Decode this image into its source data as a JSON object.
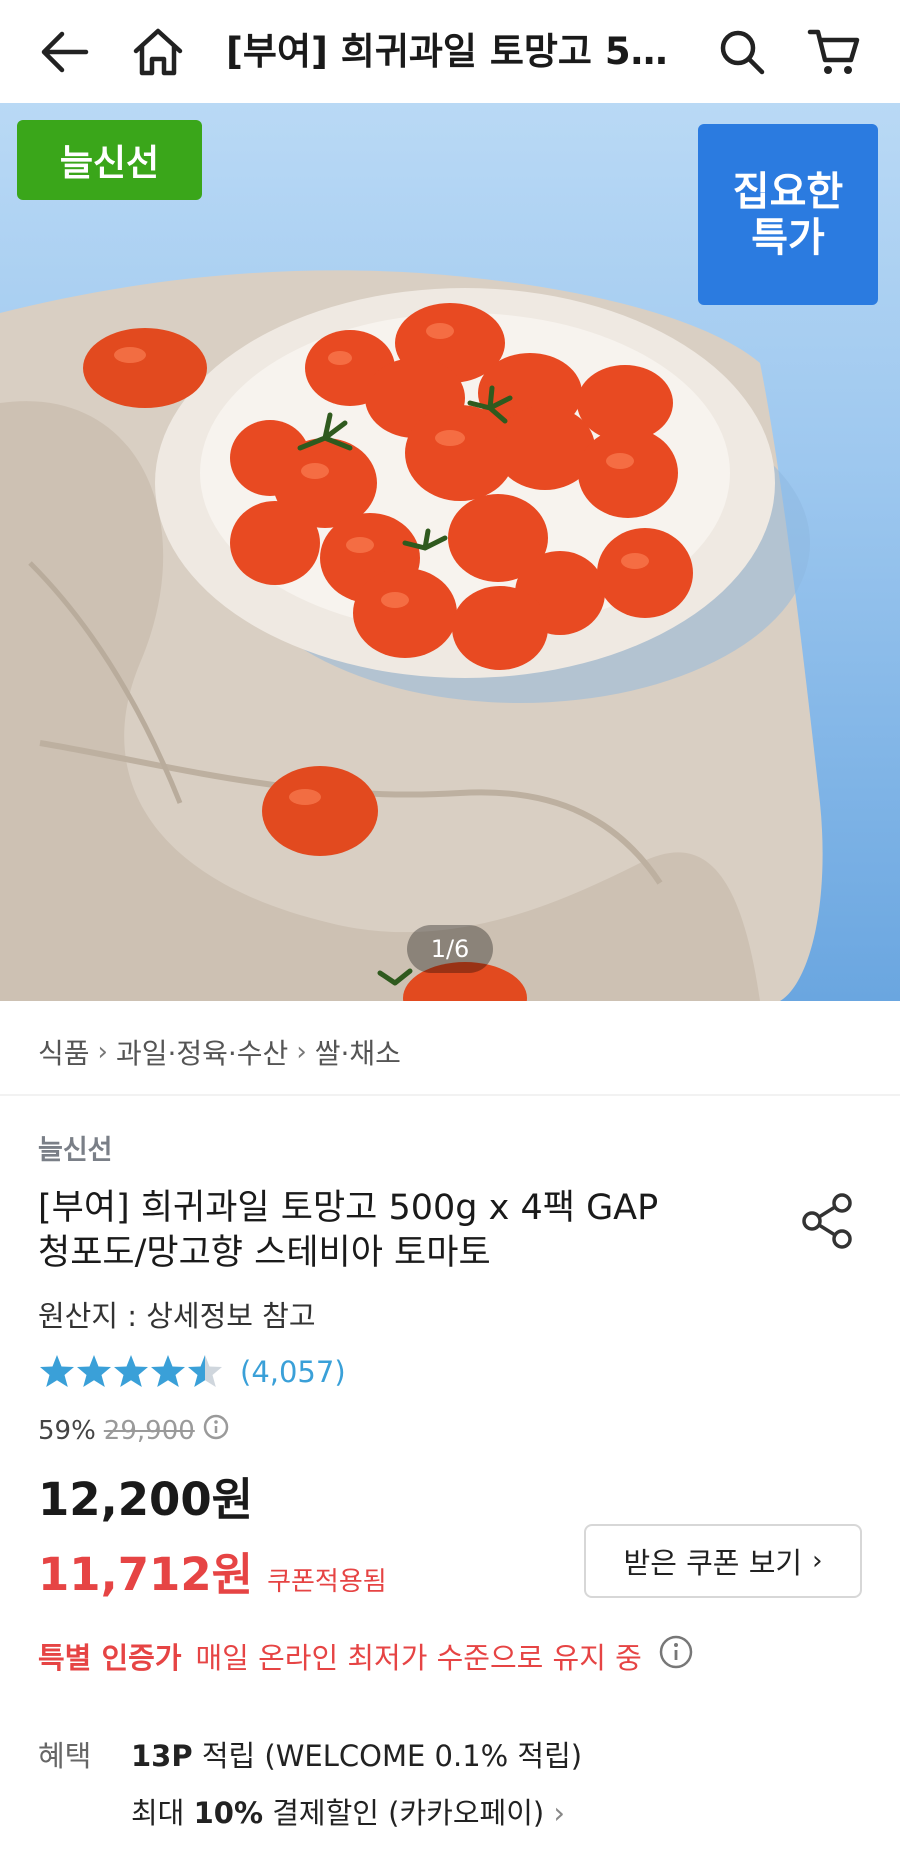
{
  "header": {
    "title": "[부여] 희귀과일 토망고 500g x 4팩 GAP 청포도/망고향 스테비아 토마토",
    "icons": [
      "back-arrow-icon",
      "home-icon",
      "search-icon",
      "cart-icon"
    ]
  },
  "hero": {
    "badge_fresh": "늘신선",
    "badge_deal_line1": "집요한",
    "badge_deal_line2": "특가",
    "pager": "1/6"
  },
  "breadcrumb": [
    "식품",
    "과일·정육·수산",
    "쌀·채소"
  ],
  "product": {
    "brand": "늘신선",
    "title_line1": "[부여] 희귀과일 토망고 500g x 4팩 GAP",
    "title_line2": "청포도/망고향 스테비아 토마토",
    "origin": "원산지 : 상세정보 참고",
    "rating_value": 4.5,
    "review_count": "(4,057)",
    "discount_rate": "59%",
    "original_price": "29,900",
    "price": "12,200원",
    "coupon_price": "11,712원",
    "coupon_applied_label": "쿠폰적용됨",
    "coupon_button": "받은 쿠폰 보기",
    "special_label": "특별 인증가",
    "special_desc": "매일 온라인 최저가 수준으로 유지 중"
  },
  "benefit": {
    "label": "혜택",
    "points_bold": "13P",
    "points_rest": " 적립 (WELCOME 0.1% 적립)",
    "pay_prefix": "최대 ",
    "pay_bold": "10%",
    "pay_rest": " 결제할인 (카카오페이)"
  },
  "colors": {
    "accent_red": "#e64444",
    "star_blue": "#3aa0d8",
    "badge_green": "#3aa61a",
    "badge_blue": "#2b7be0"
  }
}
